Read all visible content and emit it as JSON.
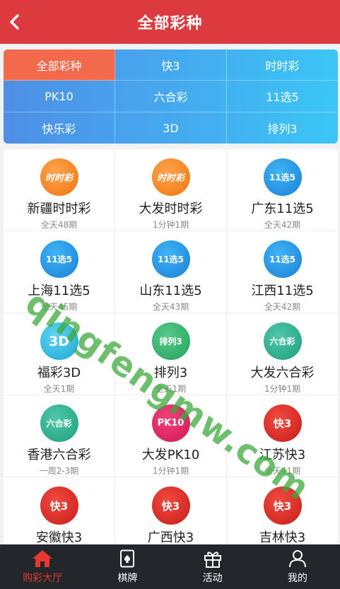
{
  "header": {
    "title": "全部彩种"
  },
  "tabs": [
    {
      "label": "全部彩种",
      "active": true
    },
    {
      "label": "快3"
    },
    {
      "label": "时时彩"
    },
    {
      "label": "PK10"
    },
    {
      "label": "六合彩"
    },
    {
      "label": "11选5"
    },
    {
      "label": "快乐彩"
    },
    {
      "label": "3D"
    },
    {
      "label": "排列3"
    }
  ],
  "lotteries": [
    {
      "name": "新疆时时彩",
      "freq": "全天48期",
      "icon": "shishicai-icon",
      "icon_text": "时时彩"
    },
    {
      "name": "大发时时彩",
      "freq": "1分钟1期",
      "icon": "shishicai-icon",
      "icon_text": "时时彩"
    },
    {
      "name": "广东11选5",
      "freq": "全天42期",
      "icon": "11xuan5-icon",
      "icon_text": "11选5"
    },
    {
      "name": "上海11选5",
      "freq": "全天45期",
      "icon": "11xuan5-icon",
      "icon_text": "11选5"
    },
    {
      "name": "山东11选5",
      "freq": "全天43期",
      "icon": "11xuan5-icon",
      "icon_text": "11选5"
    },
    {
      "name": "江西11选5",
      "freq": "全天42期",
      "icon": "11xuan5-icon",
      "icon_text": "11选5"
    },
    {
      "name": "福彩3D",
      "freq": "全天1期",
      "icon": "3d-icon",
      "icon_text": "3D"
    },
    {
      "name": "排列3",
      "freq": "全天1期",
      "icon": "pailie3-icon",
      "icon_text": "排列3"
    },
    {
      "name": "大发六合彩",
      "freq": "1分钟1期",
      "icon": "liuhecai-icon",
      "icon_text": "六合彩"
    },
    {
      "name": "香港六合彩",
      "freq": "一周2-3期",
      "icon": "liuhecai-icon",
      "icon_text": "六合彩"
    },
    {
      "name": "大发PK10",
      "freq": "1分钟1期",
      "icon": "pk10-icon",
      "icon_text": "PK10"
    },
    {
      "name": "江苏快3",
      "freq": "全天41期",
      "icon": "kuai3-icon",
      "icon_text": "快3"
    },
    {
      "name": "安徽快3",
      "freq": "",
      "icon": "kuai3-icon",
      "icon_text": "快3"
    },
    {
      "name": "广西快3",
      "freq": "",
      "icon": "kuai3-icon",
      "icon_text": "快3"
    },
    {
      "name": "吉林快3",
      "freq": "",
      "icon": "kuai3-icon",
      "icon_text": "快3"
    }
  ],
  "watermark": "qingfengmw.com",
  "tabbar": [
    {
      "label": "购彩大厅",
      "icon": "home-icon",
      "active": true
    },
    {
      "label": "棋牌",
      "icon": "cards-icon"
    },
    {
      "label": "活动",
      "icon": "gift-icon"
    },
    {
      "label": "我的",
      "icon": "user-icon"
    }
  ],
  "colors": {
    "header": "#dc3a3f",
    "tab_active": "#f3694c",
    "tab_gradient": [
      "#4f8fe6",
      "#3bc6f6"
    ],
    "tabbar_bg": "#23262b",
    "tabbar_active": "#e8372f"
  }
}
